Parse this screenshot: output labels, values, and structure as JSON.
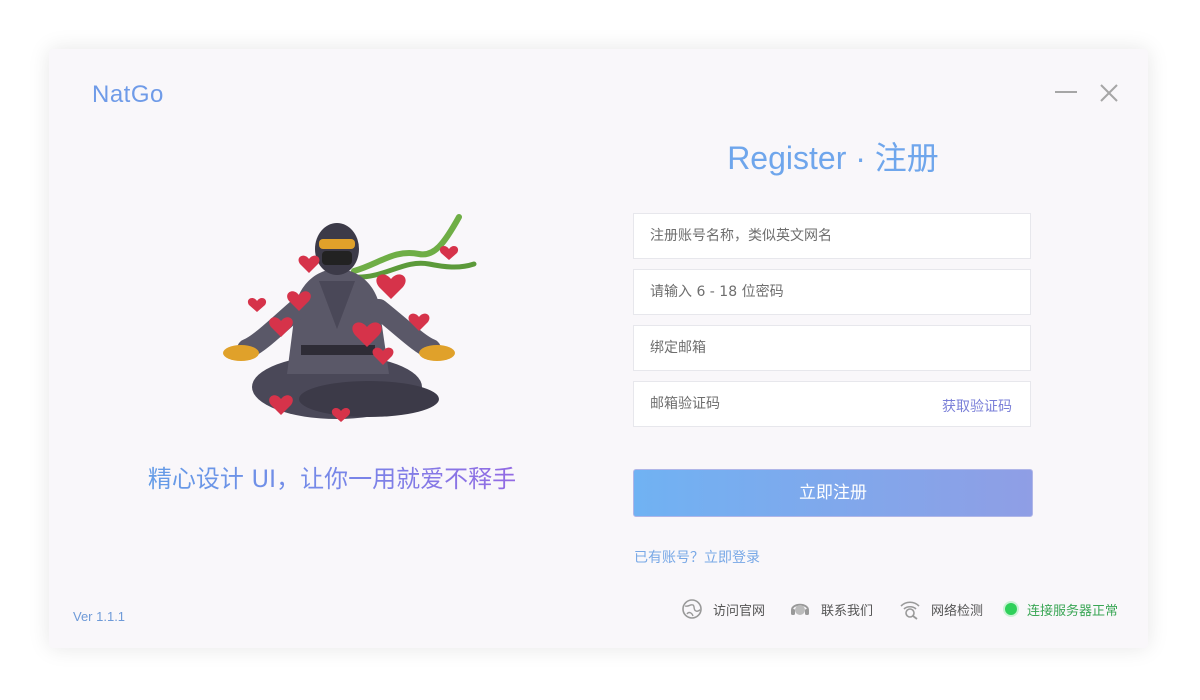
{
  "app": {
    "logo": "NatGo",
    "version": "Ver 1.1.1"
  },
  "window_controls": {
    "minimize_icon": "minimize-icon",
    "close_icon": "close-icon"
  },
  "left": {
    "tagline": "精心设计 UI，让你一用就爱不释手",
    "illustration": "meditating-ninja-with-hearts"
  },
  "form": {
    "title": "Register · 注册",
    "fields": {
      "username_placeholder": "注册账号名称，类似英文网名",
      "password_placeholder": "请输入 6 - 18 位密码",
      "email_placeholder": "绑定邮箱",
      "code_placeholder": "邮箱验证码"
    },
    "get_code_label": "获取验证码",
    "submit_label": "立即注册",
    "login_link": "已有账号？立即登录"
  },
  "footer": {
    "website": {
      "label": "访问官网",
      "icon": "globe-icon"
    },
    "contact": {
      "label": "联系我们",
      "icon": "headset-icon"
    },
    "network": {
      "label": "网络检测",
      "icon": "wifi-search-icon"
    },
    "status": {
      "label": "连接服务器正常",
      "icon": "status-dot-icon",
      "color": "#2fd05a"
    }
  },
  "colors": {
    "accent": "#6fa6ec",
    "button_start": "#70b2f3",
    "button_end": "#8f9ee5",
    "background": "#f9f7fa"
  }
}
